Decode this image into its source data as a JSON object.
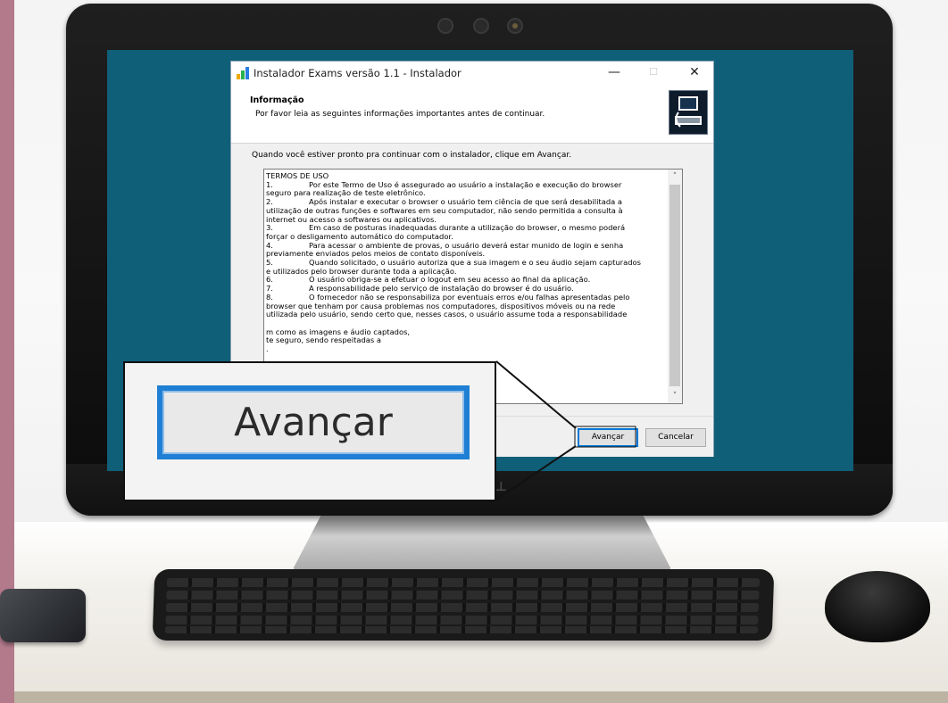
{
  "window": {
    "title": "Instalador Exams versão 1.1 - Instalador",
    "minimize_glyph": "—",
    "maximize_glyph": "☐",
    "close_glyph": "✕"
  },
  "header": {
    "title": "Informação",
    "subtitle": "Por favor leia as seguintes informações importantes antes de continuar.",
    "icon": "installer-computer-icon"
  },
  "body": {
    "ready_text": "Quando você estiver pronto pra continuar com o instalador, clique em Avançar.",
    "memo_lines": [
      {
        "num": "",
        "text": "TERMOS DE USO"
      },
      {
        "num": "1.",
        "text": "Por este Termo de Uso é assegurado ao usuário a instalação e execução do browser"
      },
      {
        "num": "",
        "text": "seguro para realização de teste eletrônico."
      },
      {
        "num": "2.",
        "text": "Após instalar e executar o browser o usuário tem ciência de que será desabilitada a"
      },
      {
        "num": "",
        "text": "utilização de outras funções e softwares em seu computador, não sendo permitida a consulta à"
      },
      {
        "num": "",
        "text": "internet ou acesso a softwares ou aplicativos."
      },
      {
        "num": "3.",
        "text": "Em caso de posturas inadequadas durante a utilização do browser, o mesmo poderá"
      },
      {
        "num": "",
        "text": "forçar o desligamento automático do computador."
      },
      {
        "num": "4.",
        "text": "Para acessar o ambiente de provas, o usuário deverá estar munido de login e senha"
      },
      {
        "num": "",
        "text": "previamente enviados pelos meios de contato disponíveis."
      },
      {
        "num": "5.",
        "text": "Quando solicitado, o usuário autoriza que a sua imagem e o seu áudio sejam capturados"
      },
      {
        "num": "",
        "text": "e utilizados pelo browser durante toda a aplicação."
      },
      {
        "num": "6.",
        "text": "O usuário obriga-se a efetuar o logout em seu acesso ao final da aplicação."
      },
      {
        "num": "7.",
        "text": "A responsabilidade pelo serviço de instalação do browser é do usuário."
      },
      {
        "num": "8.",
        "text": "O fornecedor não se responsabiliza por eventuais erros e/ou falhas apresentadas pelo"
      },
      {
        "num": "",
        "text": "browser que tenham por causa problemas nos computadores, dispositivos móveis ou na rede"
      },
      {
        "num": "",
        "text": "utilizada pelo usuário, sendo certo que, nesses casos, o usuário assume toda a responsabilidade"
      },
      {
        "num": "",
        "text": ""
      },
      {
        "num": "",
        "text": "m como as imagens e áudio captados,"
      },
      {
        "num": "",
        "text": "te seguro, sendo respeitadas a"
      },
      {
        "num": "",
        "text": "."
      }
    ]
  },
  "footer": {
    "next_label": "Avançar",
    "cancel_label": "Cancelar"
  },
  "zoom": {
    "label": "Avançar"
  },
  "colors": {
    "screen": "#0f5f78",
    "focus_blue": "#1e7fd4",
    "wall_accent": "#b37a8c"
  }
}
